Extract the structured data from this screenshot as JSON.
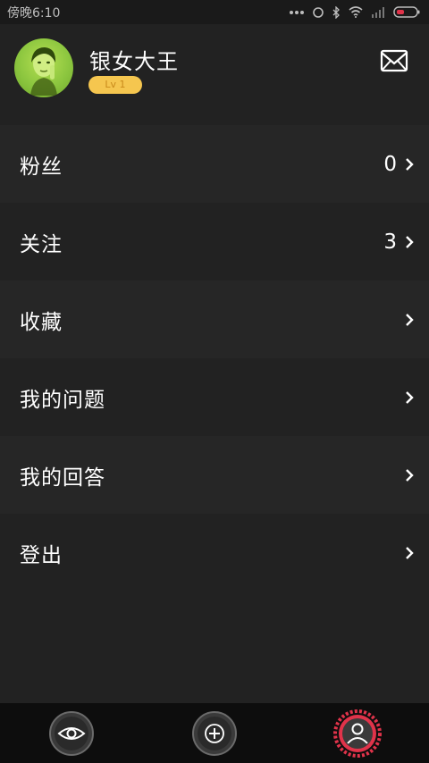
{
  "status_bar": {
    "time": "傍晚6:10"
  },
  "profile": {
    "username": "银女大王",
    "level": "Lv 1"
  },
  "menu": [
    {
      "label": "粉丝",
      "count": "0"
    },
    {
      "label": "关注",
      "count": "3"
    },
    {
      "label": "收藏",
      "count": ""
    },
    {
      "label": "我的问题",
      "count": ""
    },
    {
      "label": "我的回答",
      "count": ""
    },
    {
      "label": "登出",
      "count": ""
    }
  ],
  "colors": {
    "background": "#222222",
    "level_badge": "#f5c64f",
    "active_nav": "#e0334a",
    "avatar": "#8cc63f"
  },
  "icons": {
    "mail": "mail-icon",
    "nav": [
      "eye-icon",
      "plus-icon",
      "user-icon"
    ]
  }
}
